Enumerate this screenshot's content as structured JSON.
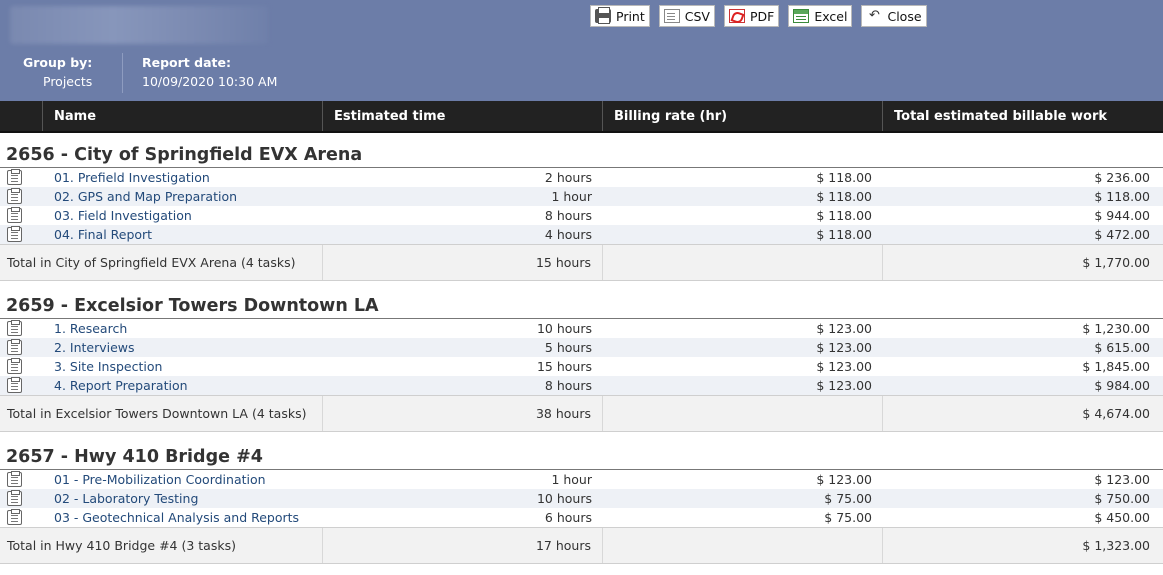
{
  "toolbar": {
    "print_label": "Print",
    "csv_label": "CSV",
    "pdf_label": "PDF",
    "excel_label": "Excel",
    "close_label": "Close"
  },
  "meta": {
    "group_by_label": "Group by:",
    "group_by_value": "Projects",
    "report_date_label": "Report date:",
    "report_date_value": "10/09/2020 10:30 AM"
  },
  "columns": [
    "Name",
    "Estimated time",
    "Billing rate (hr)",
    "Total estimated billable work"
  ],
  "groups": [
    {
      "title": "2656 - City of Springfield EVX Arena",
      "rows": [
        {
          "name": "01. Prefield Investigation",
          "est": "2 hours",
          "rate": "$ 118.00",
          "total": "$ 236.00"
        },
        {
          "name": "02. GPS and Map Preparation",
          "est": "1 hour",
          "rate": "$ 118.00",
          "total": "$ 118.00"
        },
        {
          "name": "03. Field Investigation",
          "est": "8 hours",
          "rate": "$ 118.00",
          "total": "$ 944.00"
        },
        {
          "name": "04. Final Report",
          "est": "4 hours",
          "rate": "$ 118.00",
          "total": "$ 472.00"
        }
      ],
      "total_label": "Total in City of Springfield EVX Arena (4 tasks)",
      "total_est": "15 hours",
      "total_value": "$ 1,770.00"
    },
    {
      "title": "2659 - Excelsior Towers Downtown LA",
      "rows": [
        {
          "name": "1. Research",
          "est": "10 hours",
          "rate": "$ 123.00",
          "total": "$ 1,230.00"
        },
        {
          "name": "2. Interviews",
          "est": "5 hours",
          "rate": "$ 123.00",
          "total": "$ 615.00"
        },
        {
          "name": "3. Site Inspection",
          "est": "15 hours",
          "rate": "$ 123.00",
          "total": "$ 1,845.00"
        },
        {
          "name": "4. Report Preparation",
          "est": "8 hours",
          "rate": "$ 123.00",
          "total": "$ 984.00"
        }
      ],
      "total_label": "Total in Excelsior Towers Downtown LA (4 tasks)",
      "total_est": "38 hours",
      "total_value": "$ 4,674.00"
    },
    {
      "title": "2657 - Hwy 410 Bridge #4",
      "rows": [
        {
          "name": "01 - Pre-Mobilization Coordination",
          "est": "1 hour",
          "rate": "$ 123.00",
          "total": "$ 123.00"
        },
        {
          "name": "02 - Laboratory Testing",
          "est": "10 hours",
          "rate": "$ 75.00",
          "total": "$ 750.00"
        },
        {
          "name": "03 - Geotechnical Analysis and Reports",
          "est": "6 hours",
          "rate": "$ 75.00",
          "total": "$ 450.00"
        }
      ],
      "total_label": "Total in Hwy 410 Bridge #4 (3 tasks)",
      "total_est": "17 hours",
      "total_value": "$ 1,323.00"
    }
  ]
}
